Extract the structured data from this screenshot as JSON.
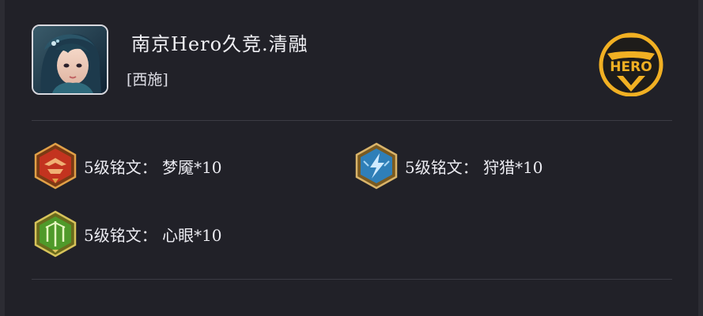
{
  "header": {
    "title": "南京Hero久竞.清融",
    "hero": "[西施]",
    "brand_text": "HERO"
  },
  "runes": [
    {
      "label": "5级铭文：  梦魇*10",
      "color": "red"
    },
    {
      "label": "5级铭文：  狩猎*10",
      "color": "blue"
    },
    {
      "label": "5级铭文：  心眼*10",
      "color": "green"
    }
  ],
  "colors": {
    "background": "#212128",
    "brand_gold": "#f1b023",
    "rune_red": "#c3331f",
    "rune_blue": "#2f7fb8",
    "rune_green": "#4f9a2a"
  }
}
